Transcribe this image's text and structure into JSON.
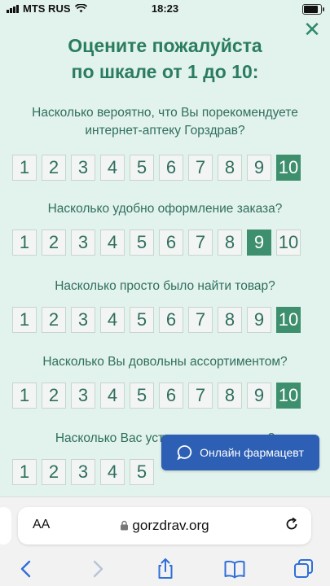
{
  "status": {
    "carrier": "MTS RUS",
    "time": "18:23"
  },
  "survey": {
    "title_line1": "Оцените пожалуйста",
    "title_line2": "по шкале от 1 до 10:",
    "scale": [
      "1",
      "2",
      "3",
      "4",
      "5",
      "6",
      "7",
      "8",
      "9",
      "10"
    ],
    "questions": [
      {
        "line1": "Насколько вероятно, что Вы порекомендуете",
        "line2": "интернет-аптеку Горздрав?",
        "selected": 10
      },
      {
        "line1": "Насколько удобно оформление заказа?",
        "line2": "",
        "selected": 9
      },
      {
        "line1": "Насколько просто было найти товар?",
        "line2": "",
        "selected": 10
      },
      {
        "line1": "Насколько Вы довольны ассортиментом?",
        "line2": "",
        "selected": 10
      },
      {
        "line1": "Насколько Вас устроили наши цены?",
        "line2": "",
        "selected": null
      }
    ],
    "pharmacist_button": "Онлайн фармацевт"
  },
  "browser": {
    "text_size": "AA",
    "url": "gorzdrav.org"
  },
  "colors": {
    "accent_green": "#3d8f6e",
    "title_green": "#2a7d5f",
    "bg_mint": "#e2f2ec",
    "chat_blue": "#2d5fb4"
  }
}
